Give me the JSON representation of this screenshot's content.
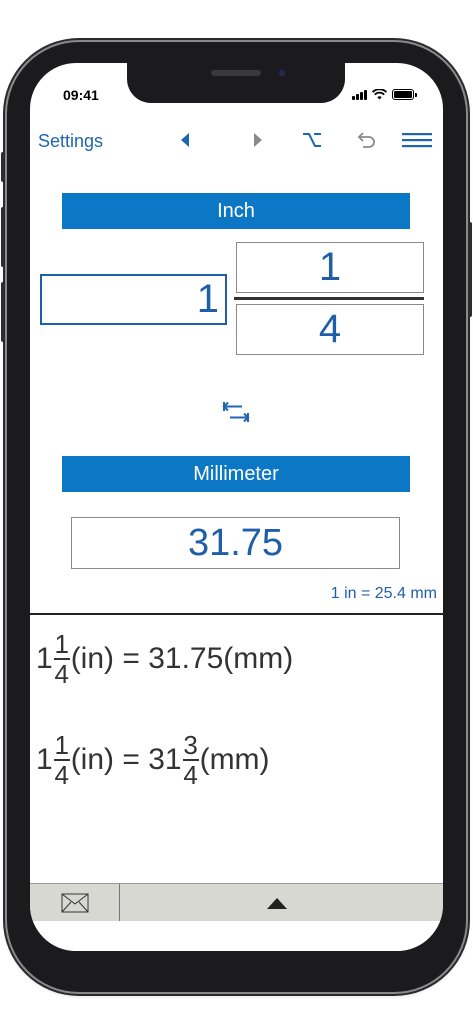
{
  "status": {
    "time": "09:41"
  },
  "toolbar": {
    "settings_label": "Settings"
  },
  "input": {
    "unit_label": "Inch",
    "whole": "1",
    "numerator": "1",
    "denominator": "4"
  },
  "output": {
    "unit_label": "Millimeter",
    "value": "31.75",
    "ratio": "1 in = 25.4 mm"
  },
  "results": [
    {
      "whole": "1",
      "num": "1",
      "den": "4",
      "mid": "(in) = 31.75(mm)"
    },
    {
      "whole": "1",
      "num": "1",
      "den": "4",
      "mid": "(in) = 31",
      "r_num": "3",
      "r_den": "4",
      "tail": "(mm)"
    }
  ],
  "colors": {
    "accent": "#0c77c4",
    "text_blue": "#1f5fa8"
  }
}
